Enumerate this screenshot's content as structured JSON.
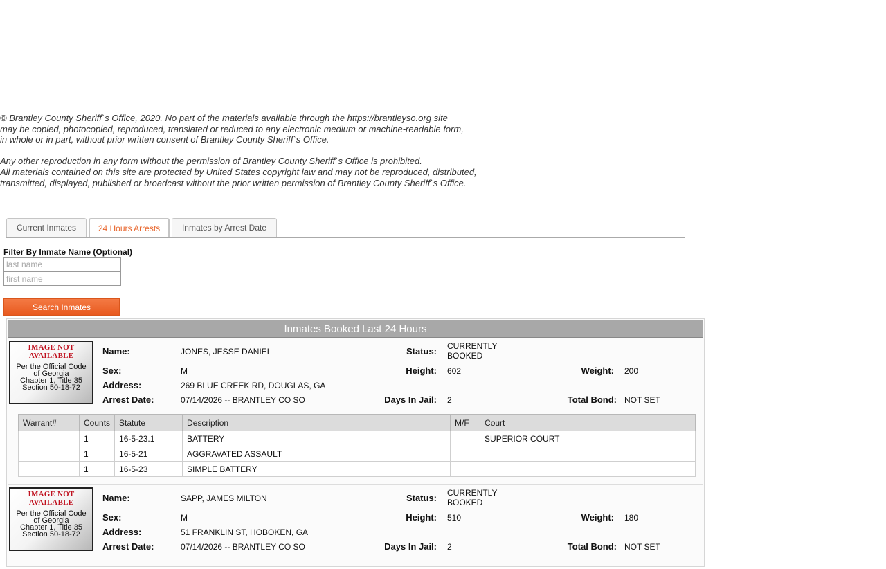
{
  "copyright": {
    "para1": [
      "© Brantley County Sheriff`s Office, 2020. No part of the materials available through the https://brantleyso.org site",
      "may be copied, photocopied, reproduced, translated or reduced to any electronic medium or machine-readable form,",
      "in whole or in part, without prior written consent of Brantley County Sheriff`s Office."
    ],
    "para2": [
      "Any other reproduction in any form without the permission of Brantley County Sheriff`s Office is prohibited.",
      "All materials contained on this site are protected by United States copyright law and may not be reproduced, distributed,",
      "transmitted, displayed, published or broadcast without the prior written permission of Brantley County Sheriff`s Office."
    ]
  },
  "tabs": [
    "Current Inmates",
    "24 Hours Arrests",
    "Inmates by Arrest Date"
  ],
  "active_tab": "24 Hours Arrests",
  "filter": {
    "label": "Filter By Inmate Name (Optional)",
    "last_placeholder": "last name",
    "first_placeholder": "first name",
    "button": "Search Inmates"
  },
  "panel_title": "Inmates Booked Last 24 Hours",
  "labels": {
    "name": "Name:",
    "status": "Status:",
    "sex": "Sex:",
    "height": "Height:",
    "weight": "Weight:",
    "address": "Address:",
    "arrest_date": "Arrest Date:",
    "days_in_jail": "Days In Jail:",
    "total_bond": "Total Bond:"
  },
  "photo": {
    "not_available": "IMAGE NOT AVAILABLE",
    "code": [
      "Per the Official Code",
      "of Georgia",
      "Chapter 1, Title 35",
      "Section 50-18-72"
    ]
  },
  "charge_headers": [
    "Warrant#",
    "Counts",
    "Statute",
    "Description",
    "M/F",
    "Court"
  ],
  "inmates": [
    {
      "name": "JONES, JESSE DANIEL",
      "status": [
        "CURRENTLY",
        "BOOKED"
      ],
      "sex": "M",
      "height": "602",
      "weight": "200",
      "address": "269 BLUE CREEK RD, DOUGLAS, GA",
      "arrest_date": "07/14/2026 -- BRANTLEY CO SO",
      "days_in_jail": "2",
      "total_bond": "NOT SET",
      "charges": [
        {
          "warrant": "",
          "counts": "1",
          "statute": "16-5-23.1",
          "description": "BATTERY",
          "mf": "",
          "court": "SUPERIOR COURT"
        },
        {
          "warrant": "",
          "counts": "1",
          "statute": "16-5-21",
          "description": "AGGRAVATED ASSAULT",
          "mf": "",
          "court": ""
        },
        {
          "warrant": "",
          "counts": "1",
          "statute": "16-5-23",
          "description": "SIMPLE BATTERY",
          "mf": "",
          "court": ""
        }
      ]
    },
    {
      "name": "SAPP, JAMES MILTON",
      "status": [
        "CURRENTLY",
        "BOOKED"
      ],
      "sex": "M",
      "height": "510",
      "weight": "180",
      "address": "51 FRANKLIN ST, HOBOKEN, GA",
      "arrest_date": "07/14/2026 -- BRANTLEY CO SO",
      "days_in_jail": "2",
      "total_bond": "NOT SET",
      "charges": []
    }
  ]
}
